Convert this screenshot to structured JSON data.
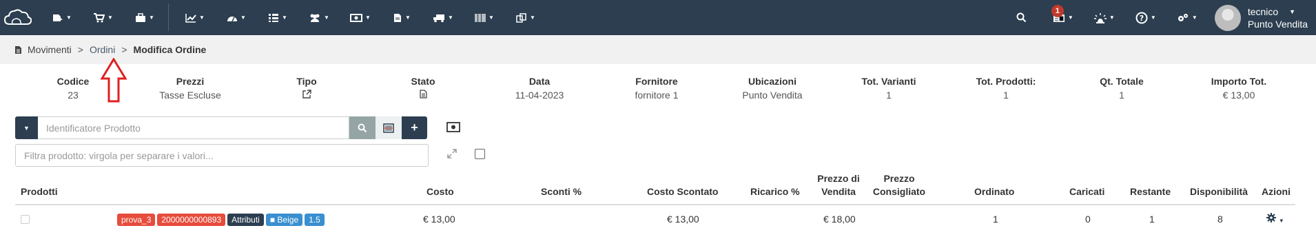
{
  "user": {
    "name": "tecnico",
    "store": "Punto Vendita"
  },
  "notifications": {
    "count": "1"
  },
  "breadcrumb": {
    "item1": "Movimenti",
    "sep": ">",
    "item2": "Ordini",
    "current": "Modifica Ordine"
  },
  "info": [
    {
      "label": "Codice",
      "value": "23"
    },
    {
      "label": "Prezzi",
      "value": "Tasse Escluse"
    },
    {
      "label": "Tipo",
      "value": ""
    },
    {
      "label": "Stato",
      "value": ""
    },
    {
      "label": "Data",
      "value": "11-04-2023"
    },
    {
      "label": "Fornitore",
      "value": "fornitore 1"
    },
    {
      "label": "Ubicazioni",
      "value": "Punto Vendita"
    },
    {
      "label": "Tot. Varianti",
      "value": "1"
    },
    {
      "label": "Tot. Prodotti:",
      "value": "1"
    },
    {
      "label": "Qt. Totale",
      "value": "1"
    },
    {
      "label": "Importo Tot.",
      "value": "€ 13,00"
    }
  ],
  "search": {
    "placeholder": "Identificatore Prodotto"
  },
  "filter": {
    "placeholder": "Filtra prodotto: virgola per separare i valori..."
  },
  "table": {
    "headers": {
      "prodotti": "Prodotti",
      "costo": "Costo",
      "sconti": "Sconti %",
      "costo_scontato": "Costo Scontato",
      "ricarico": "Ricarico %",
      "prezzo_vendita_1": "Prezzo di",
      "prezzo_vendita_2": "Vendita",
      "prezzo_consigliato_1": "Prezzo",
      "prezzo_consigliato_2": "Consigliato",
      "ordinato": "Ordinato",
      "caricati": "Caricati",
      "restante": "Restante",
      "disponibilita": "Disponibilità",
      "azioni": "Azioni"
    },
    "row": {
      "tags": {
        "name": "prova_3",
        "barcode": "2000000000893",
        "attributi": "Attributi",
        "color": "Beige",
        "size": "1.5"
      },
      "costo": "€ 13,00",
      "costo_scontato": "€ 13,00",
      "prezzo_vendita": "€ 18,00",
      "ordinato": "1",
      "caricati": "0",
      "restante": "1",
      "disponibilita": "8"
    }
  },
  "colors": {
    "navbar": "#2c3e50",
    "tag_red": "#e74c3c",
    "tag_blue": "#3a8fd0",
    "annotation_arrow": "#e02020"
  },
  "icons": [
    "cloud-logo-icon",
    "movements-icon",
    "cart-icon",
    "briefcase-icon",
    "chart-icon",
    "dashboard-icon",
    "list-icon",
    "users-icon",
    "money-icon",
    "document-icon",
    "truck-icon",
    "barcode-icon",
    "copy-icon",
    "search-icon",
    "notification-icon",
    "alert-icon",
    "help-icon",
    "settings-icon"
  ]
}
